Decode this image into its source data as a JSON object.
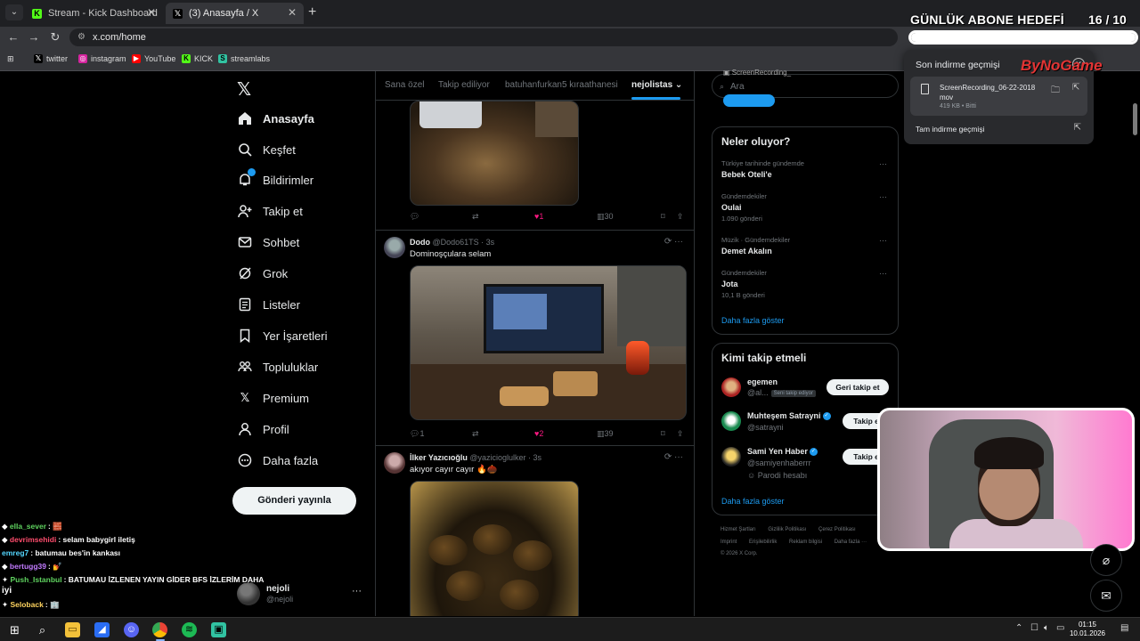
{
  "browser": {
    "tabs": [
      {
        "title": "Stream - Kick Dashboard",
        "favicon": "kick-icon"
      },
      {
        "title": "(3) Anasayfa / X",
        "favicon": "x-icon",
        "active": true
      }
    ],
    "url": "x.com/home",
    "bookmarks": [
      "twitter",
      "instagram",
      "YouTube",
      "KICK",
      "streamlabs"
    ]
  },
  "x_nav": {
    "items": [
      {
        "label": "Anasayfa",
        "icon": "home-icon",
        "active": true
      },
      {
        "label": "Keşfet",
        "icon": "search-icon"
      },
      {
        "label": "Bildirimler",
        "icon": "bell-icon",
        "badge": true
      },
      {
        "label": "Takip et",
        "icon": "add-user-icon"
      },
      {
        "label": "Sohbet",
        "icon": "mail-icon"
      },
      {
        "label": "Grok",
        "icon": "grok-icon"
      },
      {
        "label": "Listeler",
        "icon": "list-icon"
      },
      {
        "label": "Yer İşaretleri",
        "icon": "bookmark-icon"
      },
      {
        "label": "Topluluklar",
        "icon": "communities-icon"
      },
      {
        "label": "Premium",
        "icon": "x-premium-icon"
      },
      {
        "label": "Profil",
        "icon": "profile-icon"
      },
      {
        "label": "Daha fazla",
        "icon": "more-circle-icon"
      }
    ],
    "post_button": "Gönderi yayınla",
    "account": {
      "name": "nejoli",
      "handle": "@nejoli",
      "more": "···"
    }
  },
  "feed": {
    "tabs": [
      "Sana özel",
      "Takip ediliyor",
      "batuhanfurkan5 kıraathanesi",
      "nejolistas"
    ],
    "active_tab": 3,
    "tweet0": {
      "reply": "",
      "retweet": "",
      "likes": "1",
      "views": "30"
    },
    "tweet1": {
      "name": "Dodo",
      "handle": "@Dodo61TS · 3s",
      "text": "Dominoşçulara selam",
      "replies": "1",
      "likes": "2",
      "views": "39"
    },
    "tweet2": {
      "name": "İlker Yazıcıoğlu",
      "handle": "@yazicioglulker · 3s",
      "text": "akıyor cayır cayır 🔥🌰"
    }
  },
  "right_col": {
    "search_placeholder": "Ara",
    "trends_title": "Neler oluyor?",
    "trends": [
      {
        "category": "Türkiye tarihinde gündemde",
        "name": "Bebek Oteli'e",
        "count": ""
      },
      {
        "category": "Gündemdekiler",
        "name": "Oulai",
        "count": "1.090 gönderi"
      },
      {
        "category": "Müzik · Gündemdekiler",
        "name": "Demet Akalın",
        "count": ""
      },
      {
        "category": "Gündemdekiler",
        "name": "Jota",
        "count": "10,1 B gönderi"
      }
    ],
    "show_more": "Daha fazla göster",
    "who_to_follow_title": "Kimi takip etmeli",
    "suggestions": [
      {
        "name": "egemen",
        "handle": "@al...",
        "follows_you": "Seni takip ediyor",
        "button": "Geri takip et",
        "verified": false
      },
      {
        "name": "Muhteşem Satrayni",
        "handle": "@satrayni",
        "button": "Takip et",
        "verified": true
      },
      {
        "name": "Sami Yen Haber",
        "handle": "@samiyenhaberrr",
        "note": "Parodi hesabı",
        "button": "Takip et",
        "verified": true
      }
    ],
    "show_more_2": "Daha fazla göster",
    "footer": [
      "Hizmet Şartları",
      "Gizlilik Politikası",
      "Çerez Politikası",
      "Imprint",
      "Erişilebilirlik",
      "Reklam bilgisi",
      "Daha fazla ···",
      "© 2026 X Corp."
    ]
  },
  "downloads": {
    "title": "Son indirme geçmişi",
    "file": "ScreenRecording_06-22-2018 mov",
    "size": "419 KB • Bitti",
    "full_history": "Tam indirme geçmişi"
  },
  "overlay": {
    "goal_title": "GÜNLÜK ABONE HEDEFİ",
    "goal_current": "16",
    "goal_sep": "/ 10",
    "goal_progress": 1.0,
    "brand": "ByNoGame",
    "ghost_text": "ScreenRecording_",
    "chat": [
      {
        "user": "ella_sever",
        "msg": "🧱",
        "color": "#5fd35f"
      },
      {
        "user": "devrimsehidi",
        "msg": "selam babygirl iletiş",
        "color": "#ff4d6d"
      },
      {
        "user": "emreg7",
        "msg": "batumau bes'in kankası",
        "color": "#54d6ff"
      },
      {
        "user": "bertugg39",
        "msg": "💅",
        "color": "#c27bff"
      },
      {
        "user": "Push_Istanbul",
        "msg": "BATUMAU İZLENEN YAYIN GİDER BFS İZLERİM DAHA",
        "color": "#5fd35f"
      },
      {
        "user": "",
        "msg": "iyi",
        "color": "#ffffff"
      },
      {
        "user": "Seloback",
        "msg": "🏢",
        "color": "#ffd45f"
      }
    ]
  },
  "taskbar": {
    "time": "01:15",
    "date": "10.01.2026"
  }
}
